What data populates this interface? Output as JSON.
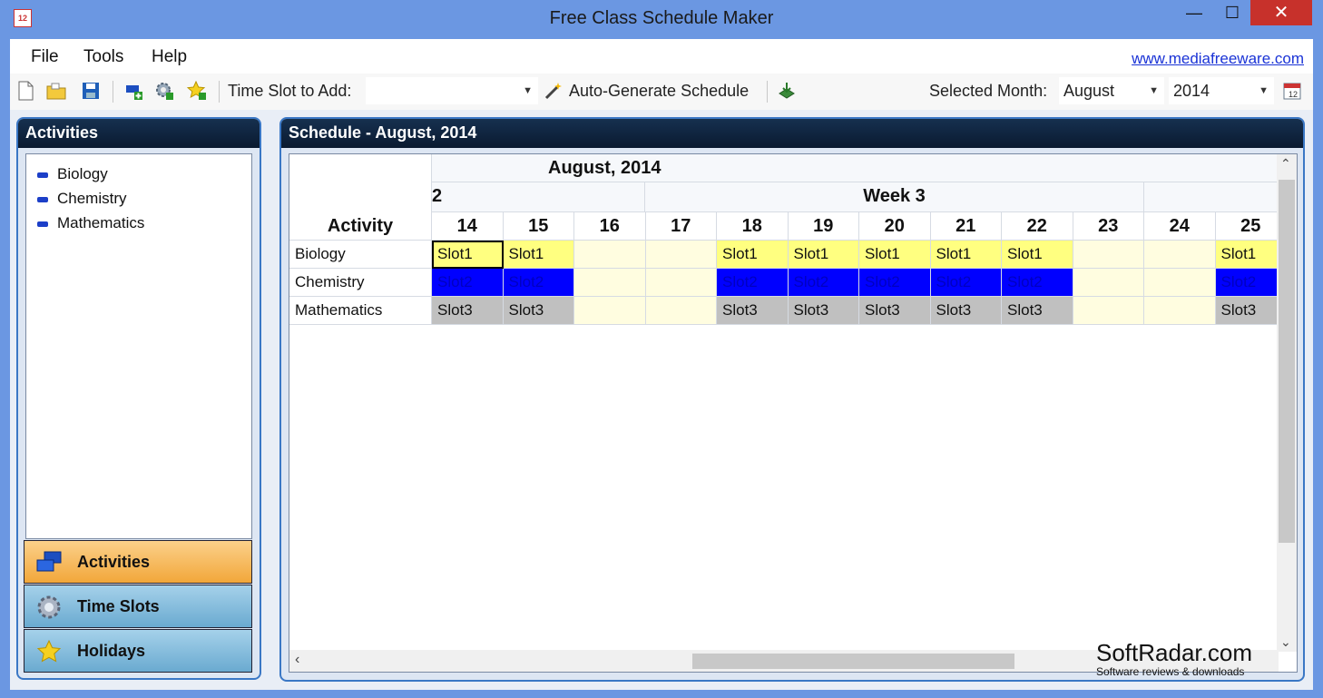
{
  "window": {
    "title": "Free Class Schedule Maker",
    "app_icon_text": "12"
  },
  "menu": {
    "items": [
      "File",
      "Tools",
      "Help"
    ],
    "website": "www.mediafreeware.com"
  },
  "toolbar": {
    "time_slot_label": "Time Slot to Add:",
    "time_slot_value": "",
    "auto_generate_label": "Auto-Generate Schedule",
    "selected_month_label": "Selected Month:",
    "month_value": "August",
    "year_value": "2014"
  },
  "activities_panel": {
    "title": "Activities",
    "items": [
      "Biology",
      "Chemistry",
      "Mathematics"
    ]
  },
  "nav_buttons": [
    {
      "label": "Activities",
      "icon": "activities-icon",
      "active": true
    },
    {
      "label": "Time Slots",
      "icon": "gear-icon",
      "active": false
    },
    {
      "label": "Holidays",
      "icon": "star-icon",
      "active": false
    }
  ],
  "schedule": {
    "panel_title": "Schedule - August, 2014",
    "month_header": "August, 2014",
    "week_prev_fragment": "2",
    "week_header": "Week 3",
    "activity_header": "Activity",
    "days": [
      "14",
      "15",
      "16",
      "17",
      "18",
      "19",
      "20",
      "21",
      "22",
      "23",
      "24",
      "25"
    ],
    "rows": [
      {
        "activity": "Biology",
        "cells": [
          "Slot1",
          "Slot1",
          "",
          "",
          "Slot1",
          "Slot1",
          "Slot1",
          "Slot1",
          "Slot1",
          "",
          "",
          "Slot1"
        ]
      },
      {
        "activity": "Chemistry",
        "cells": [
          "Slot2",
          "Slot2",
          "",
          "",
          "Slot2",
          "Slot2",
          "Slot2",
          "Slot2",
          "Slot2",
          "",
          "",
          "Slot2"
        ]
      },
      {
        "activity": "Mathematics",
        "cells": [
          "Slot3",
          "Slot3",
          "",
          "",
          "Slot3",
          "Slot3",
          "Slot3",
          "Slot3",
          "Slot3",
          "",
          "",
          "Slot3"
        ]
      }
    ],
    "slot_colors": {
      "Slot1": "#ffff80",
      "Slot2": "#0000ff",
      "Slot3": "#c0c0c0",
      "empty": "#fffde0"
    },
    "slot_text_colors": {
      "Slot1": "#111111",
      "Slot2": "#0000c0",
      "Slot3": "#111111"
    }
  },
  "watermark": {
    "main": "SoftRadar.com",
    "sub": "Software reviews & downloads"
  }
}
